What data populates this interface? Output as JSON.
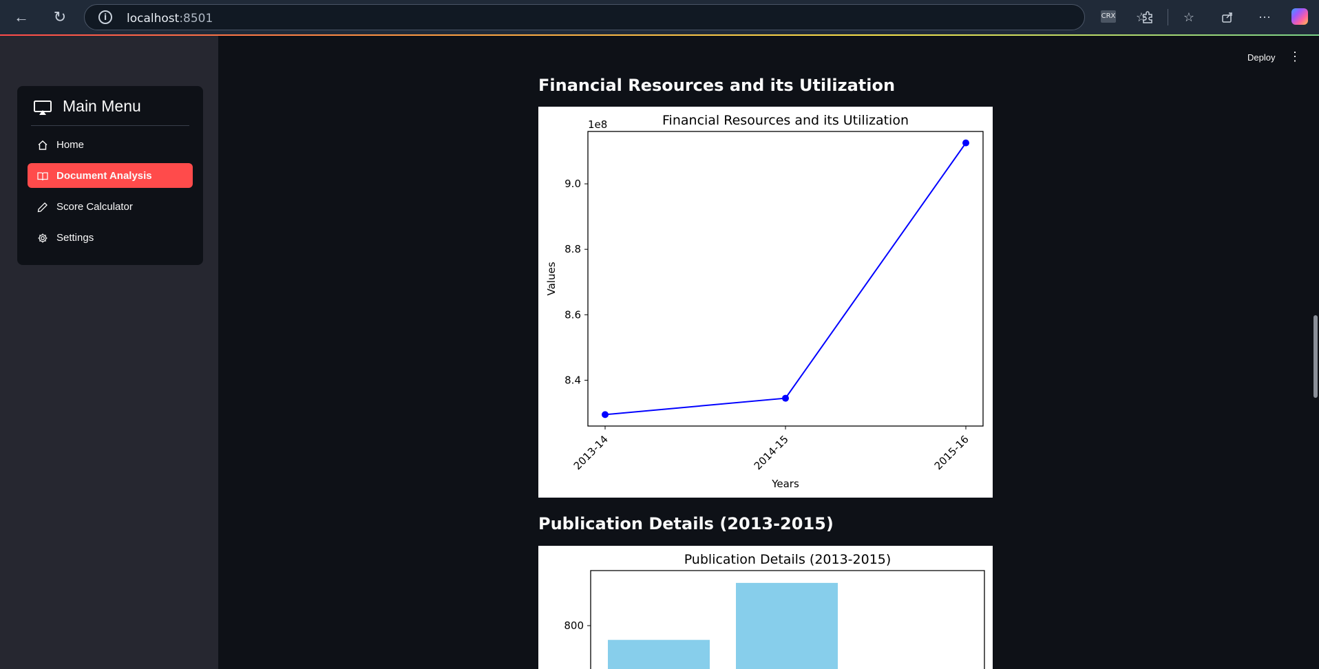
{
  "browser": {
    "url_host": "localhost",
    "url_port": ":8501",
    "crx_label": "CRX"
  },
  "sidebar": {
    "title": "Main Menu",
    "items": [
      {
        "label": "Home",
        "icon": "house-icon",
        "active": false
      },
      {
        "label": "Document Analysis",
        "icon": "book-icon",
        "active": true
      },
      {
        "label": "Score Calculator",
        "icon": "pencil-icon",
        "active": false
      },
      {
        "label": "Settings",
        "icon": "gear-icon",
        "active": false
      }
    ]
  },
  "header": {
    "deploy_label": "Deploy"
  },
  "sections": [
    {
      "title": "Financial Resources and its Utilization"
    },
    {
      "title": "Publication Details (2013-2015)"
    }
  ],
  "chart_data": [
    {
      "type": "line",
      "title": "Financial Resources and its Utilization",
      "xlabel": "Years",
      "ylabel": "Values",
      "scale_label": "1e8",
      "categories": [
        "2013-14",
        "2014-15",
        "2015-16"
      ],
      "values": [
        829500000,
        834500000,
        912500000
      ],
      "yticks": [
        8.4,
        8.6,
        8.8,
        9.0
      ],
      "ylim": [
        826000000,
        916000000
      ],
      "color": "#0000ff",
      "marker": "circle"
    },
    {
      "type": "bar",
      "title": "Publication Details (2013-2015)",
      "yticks": [
        800
      ],
      "values": [
        755,
        935
      ],
      "color": "#87ceeb"
    }
  ]
}
